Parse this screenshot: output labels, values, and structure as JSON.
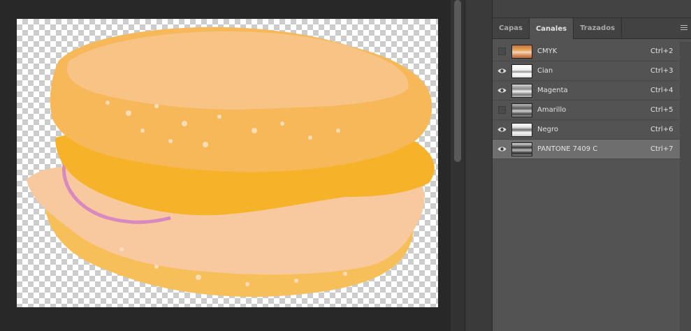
{
  "panel": {
    "tabs": [
      {
        "label": "Capas",
        "active": false
      },
      {
        "label": "Canales",
        "active": true
      },
      {
        "label": "Trazados",
        "active": false
      }
    ],
    "menu_icon": "hamburger-menu-icon"
  },
  "channels": [
    {
      "name": "CMYK",
      "shortcut": "Ctrl+2",
      "visible": false,
      "selected": false,
      "thumb": "color"
    },
    {
      "name": "Cian",
      "shortcut": "Ctrl+3",
      "visible": true,
      "selected": false,
      "thumb": "light"
    },
    {
      "name": "Magenta",
      "shortcut": "Ctrl+4",
      "visible": true,
      "selected": false,
      "thumb": "mid"
    },
    {
      "name": "Amarillo",
      "shortcut": "Ctrl+5",
      "visible": false,
      "selected": false,
      "thumb": "dark"
    },
    {
      "name": "Negro",
      "shortcut": "Ctrl+6",
      "visible": true,
      "selected": false,
      "thumb": "light"
    },
    {
      "name": "PANTONE 7409 C",
      "shortcut": "Ctrl+7",
      "visible": true,
      "selected": true,
      "thumb": "dark"
    }
  ],
  "colors": {
    "spot": "#f6b32a",
    "bread": "#f7ba6a",
    "ham": "#f9c7a6",
    "onion": "#d98ac4"
  }
}
